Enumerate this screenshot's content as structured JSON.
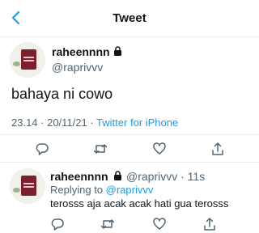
{
  "header": {
    "title": "Tweet",
    "back_icon": "back-arrow-icon"
  },
  "tweet": {
    "name": "raheennnn",
    "handle": "@raprivvv",
    "text": "bahaya ni cowo",
    "time": "23.14 · 20/11/21 · ",
    "source": "Twitter for iPhone"
  },
  "reply": {
    "name": "raheennnn",
    "handle": "@raprivvv",
    "age": "· 11s",
    "replying_prefix": "Replying to ",
    "replying_to": "@raprivvv",
    "text": "terosss aja acak acak hati gua terosss"
  },
  "icons": {
    "reply": "comment-icon",
    "retweet": "retweet-icon",
    "like": "heart-icon",
    "share": "share-icon",
    "lock": "lock-icon"
  },
  "colors": {
    "accent": "#1d9bf0",
    "text": "#0f1419",
    "muted": "#536471"
  }
}
